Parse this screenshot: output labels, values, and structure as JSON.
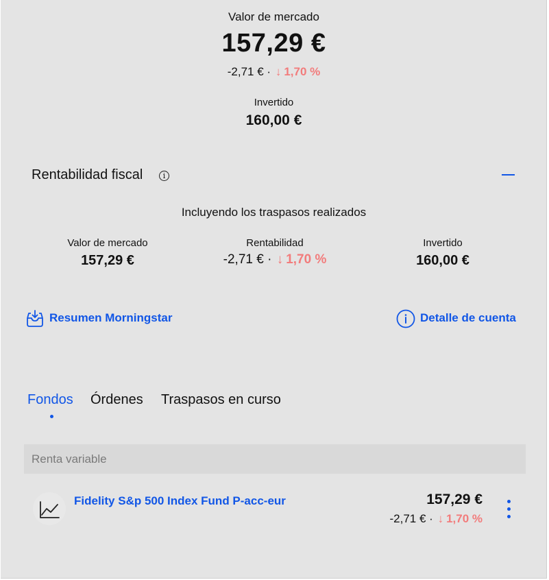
{
  "summary": {
    "market_label": "Valor de mercado",
    "market_value": "157,29 €",
    "change_amount": "-2,71 €",
    "separator": "·",
    "arrow": "↓",
    "change_percent": "1,70 %",
    "invested_label": "Invertido",
    "invested_value": "160,00 €"
  },
  "fiscal": {
    "title": "Rentabilidad fiscal",
    "info_glyph": "i",
    "subtitle": "Incluyendo los traspasos realizados",
    "columns": [
      {
        "label": "Valor de mercado",
        "value": "157,29 €"
      },
      {
        "label": "Rentabilidad",
        "change_amount": "-2,71 €",
        "separator": "·",
        "arrow": "↓",
        "change_percent": "1,70 %"
      },
      {
        "label": "Invertido",
        "value": "160,00 €"
      }
    ]
  },
  "links": {
    "morningstar": "Resumen Morningstar",
    "account_detail": "Detalle de cuenta"
  },
  "tabs": [
    {
      "label": "Fondos",
      "active": true
    },
    {
      "label": "Órdenes",
      "active": false
    },
    {
      "label": "Traspasos en curso",
      "active": false
    }
  ],
  "section": {
    "label": "Renta variable"
  },
  "funds": [
    {
      "name": "Fidelity S&p 500 Index Fund P-acc-eur",
      "value": "157,29 €",
      "change_amount": "-2,71 €",
      "separator": "·",
      "arrow": "↓",
      "change_percent": "1,70 %",
      "icon": "line-chart-icon"
    }
  ],
  "colors": {
    "accent": "#1156e6",
    "negative": "#f27c7c",
    "background": "#e4e4e4"
  },
  "icons": {
    "info": "info-icon",
    "collapse": "minus-icon",
    "morningstar": "inbox-download-icon",
    "account_detail": "info-circle-icon",
    "more": "more-vertical-icon"
  }
}
